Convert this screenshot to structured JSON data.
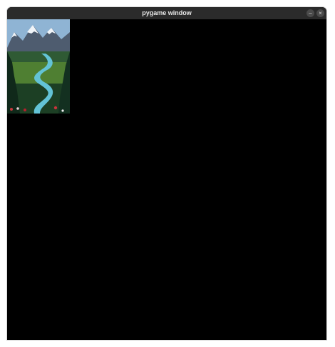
{
  "window": {
    "title": "pygame window",
    "minimize_icon": "minimize-icon",
    "close_icon": "close-icon"
  },
  "content": {
    "image_icon": "landscape-image"
  }
}
